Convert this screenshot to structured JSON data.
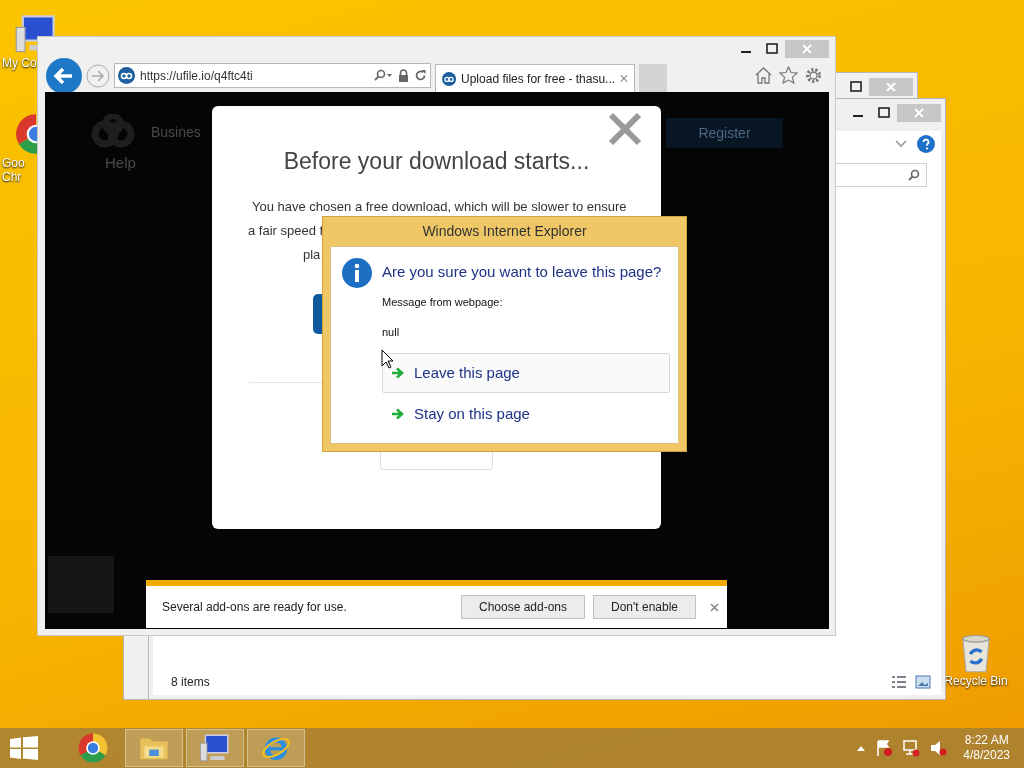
{
  "desktop_icons": [
    {
      "kind": "computer",
      "lines": [
        "My Co"
      ]
    },
    {
      "kind": "chrome",
      "lines": [
        "Goo",
        "Chr"
      ]
    },
    {
      "kind": "recycle_bin",
      "lines": [
        "Recycle Bin"
      ]
    }
  ],
  "browser": {
    "url": "https://ufile.io/q4ftc4ti",
    "tabs": [
      {
        "title": "Upload files for free - thasu...",
        "selected": true
      }
    ],
    "page": {
      "nav": [
        "Busines",
        "Help"
      ],
      "register": "Register",
      "modal": {
        "title": "Before your download starts...",
        "lines": [
          "You have chosen a free download, which will be slower to ensure",
          "a fair speed f",
          "pla"
        ]
      }
    },
    "dialog": {
      "title": "Windows Internet Explorer",
      "question": "Are you sure you want to leave this page?",
      "message_label": "Message from webpage:",
      "message": "null",
      "options": [
        {
          "label": "Leave this page",
          "selected": true
        },
        {
          "label": "Stay on this page",
          "selected": false
        }
      ]
    },
    "notification": {
      "message": "Several add-ons are ready for use.",
      "buttons": [
        "Choose add-ons",
        "Don't enable"
      ]
    }
  },
  "explorer": {
    "status": "8 items"
  },
  "taskbar": {
    "apps": [
      {
        "kind": "chrome",
        "running": false
      },
      {
        "kind": "explorer",
        "running": true
      },
      {
        "kind": "computer",
        "running": true
      },
      {
        "kind": "ie",
        "running": true
      }
    ],
    "time": "8:22 AM",
    "date": "4/8/2023"
  }
}
